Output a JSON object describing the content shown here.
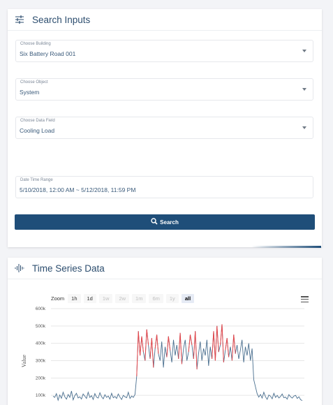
{
  "search_panel": {
    "title": "Search Inputs",
    "fields": [
      {
        "label": "Choose Building",
        "value": "Six Battery Road 001"
      },
      {
        "label": "Choose Object",
        "value": "System"
      },
      {
        "label": "Choose Data Field",
        "value": "Cooling Load"
      },
      {
        "label": "Date Time Range",
        "value": "5/10/2018, 12:00 AM ~ 5/12/2018, 11:59 PM"
      }
    ],
    "search_label": "Search"
  },
  "ts_panel": {
    "title": "Time Series Data",
    "zoom_label": "Zoom",
    "zoom_options": [
      "1h",
      "1d",
      "1w",
      "2w",
      "1m",
      "6m",
      "1y",
      "all"
    ],
    "zoom_selected": "all"
  },
  "colors": {
    "accent": "#1f4e79",
    "series_line": "#4a6f8f",
    "highlight": "#e8474b"
  },
  "chart_data": {
    "type": "line",
    "title": "",
    "xlabel": "",
    "ylabel": "Value",
    "yticks": [
      "100k",
      "200k",
      "300k",
      "400k",
      "500k",
      "600k"
    ],
    "ylim": [
      0,
      600000
    ],
    "series": [
      {
        "values": [
          95000,
          88000,
          110000,
          72000,
          102000,
          83000,
          118000,
          92000,
          78000,
          105000,
          88000,
          125000,
          74000,
          98000,
          112000,
          85000,
          92000,
          79000,
          108000,
          95000,
          82000,
          118000,
          88000,
          98000,
          76000,
          110000,
          90000,
          84000,
          115000,
          92000,
          80000,
          104000,
          88000,
          96000,
          78000,
          112000,
          86000,
          94000,
          82000,
          108000,
          90000,
          76000,
          100000,
          92000,
          86000,
          118000,
          82000,
          96000,
          88000,
          105000,
          210000,
          470000,
          330000,
          440000,
          350000,
          300000,
          480000,
          390000,
          310000,
          430000,
          260000,
          370000,
          450000,
          340000,
          300000,
          410000,
          260000,
          380000,
          320000,
          440000,
          360000,
          290000,
          420000,
          330000,
          390000,
          310000,
          460000,
          280000,
          370000,
          420000,
          300000,
          350000,
          450000,
          390000,
          310000,
          470000,
          250000,
          340000,
          410000,
          300000,
          370000,
          330000,
          420000,
          270000,
          380000,
          310000,
          470000,
          300000,
          500000,
          350000,
          390000,
          510000,
          290000,
          360000,
          430000,
          320000,
          380000,
          300000,
          450000,
          340000,
          390000,
          310000,
          360000,
          420000,
          290000,
          380000,
          330000,
          400000,
          300000,
          370000,
          190000,
          150000,
          110000,
          90000,
          105000,
          84000,
          118000,
          92000,
          77000,
          102000,
          95000,
          80000,
          112000,
          88000,
          100000,
          85000,
          94000,
          108000,
          86000,
          90000,
          78000,
          104000,
          92000,
          84000,
          96000,
          100000,
          82000,
          92000,
          75000,
          70000
        ]
      }
    ]
  }
}
